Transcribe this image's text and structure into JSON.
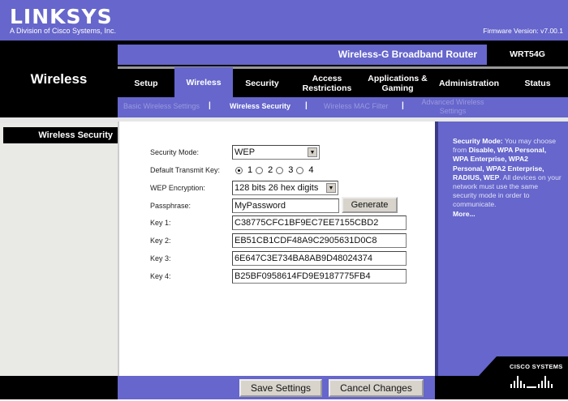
{
  "header": {
    "logo": "LINKSYS",
    "logo_sub": "A Division of Cisco Systems, Inc.",
    "firmware": "Firmware Version: v7.00.1",
    "product": "Wireless-G Broadband Router",
    "model": "WRT54G",
    "section": "Wireless"
  },
  "tabs": [
    {
      "label": "Setup"
    },
    {
      "label": "Wireless"
    },
    {
      "label": "Security"
    },
    {
      "label": "Access Restrictions"
    },
    {
      "label": "Applications & Gaming"
    },
    {
      "label": "Administration"
    },
    {
      "label": "Status"
    }
  ],
  "subnav": [
    {
      "label": "Basic Wireless Settings"
    },
    {
      "label": "Wireless Security"
    },
    {
      "label": "Wireless MAC Filter"
    },
    {
      "label": "Advanced Wireless Settings"
    }
  ],
  "sidebar": {
    "label": "Wireless Security"
  },
  "form": {
    "security_mode_label": "Security Mode:",
    "security_mode_value": "WEP",
    "transmit_key_label": "Default Transmit  Key:",
    "transmit_keys": [
      "1",
      "2",
      "3",
      "4"
    ],
    "transmit_key_selected": "1",
    "wep_label": "WEP Encryption:",
    "wep_value": "128 bits 26 hex digits",
    "passphrase_label": "Passphrase:",
    "passphrase_value": "MyPassword",
    "generate": "Generate",
    "keys": [
      {
        "label": "Key 1:",
        "value": "C38775CFC1BF9EC7EE7155CBD2"
      },
      {
        "label": "Key 2:",
        "value": "EB51CB1CDF48A9C2905631D0C8"
      },
      {
        "label": "Key 3:",
        "value": "6E647C3E734BA8AB9D48024374"
      },
      {
        "label": "Key 4:",
        "value": "B25BF0958614FD9E9187775FB4"
      }
    ]
  },
  "help": {
    "title": "Security Mode:",
    "t1": " You may choose from ",
    "modes": "Disable, WPA Personal, WPA Enterprise, WPA2 Personal, WPA2 Enterprise, RADIUS, WEP",
    "t2": ". All devices on your network must use the same security mode in order to communicate.",
    "more": "More..."
  },
  "footer": {
    "save": "Save Settings",
    "cancel": "Cancel Changes",
    "cisco": "CISCO SYSTEMS"
  },
  "colors": {
    "brand_purple": "#6666cc",
    "black": "#000000"
  }
}
